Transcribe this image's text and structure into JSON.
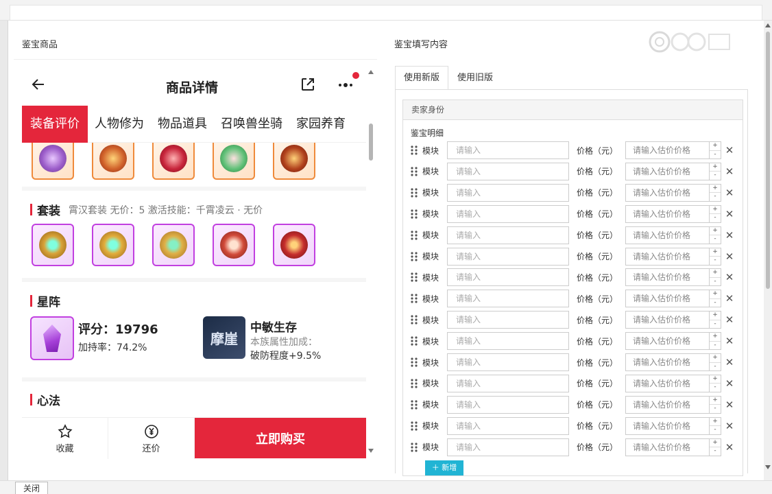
{
  "left_panel": {
    "title": "鉴宝商品"
  },
  "right_panel": {
    "title": "鉴宝填写内容"
  },
  "phone": {
    "title": "商品详情",
    "tabs": [
      "装备评价",
      "人物修为",
      "物品道具",
      "召唤兽坐骑",
      "家园养育"
    ],
    "set_section": {
      "title": "套装",
      "meta": "霄汉套装   无价：5   激活技能：千霄凌云 · 无价"
    },
    "star_section": {
      "title": "星阵",
      "score": "评分：19796",
      "rate": "加持率：74.2%",
      "rune_image_text": "摩崖",
      "rune_name": "中敏生存",
      "rune_desc": "本族属性加成：",
      "rune_bonus": "破防程度+9.5%"
    },
    "mind_section": {
      "title": "心法"
    },
    "bottom": {
      "favorite": "收藏",
      "bargain": "还价",
      "buy": "立即购买"
    }
  },
  "form": {
    "tabs": [
      "使用新版",
      "使用旧版"
    ],
    "section_title": "卖家身份",
    "detail_label": "鉴宝明细",
    "row_label": "模块",
    "row_placeholder": "请输入",
    "price_label": "价格（元）",
    "price_placeholder": "请输入估价价格",
    "rows": 15,
    "add_button": "新增"
  },
  "footer": {
    "close_button": "关闭"
  },
  "colors": {
    "accent_red": "#e4263b",
    "add_button": "#21b4d4",
    "orange_frame": "#ef8a3a",
    "purple_frame": "#c13fe0"
  }
}
